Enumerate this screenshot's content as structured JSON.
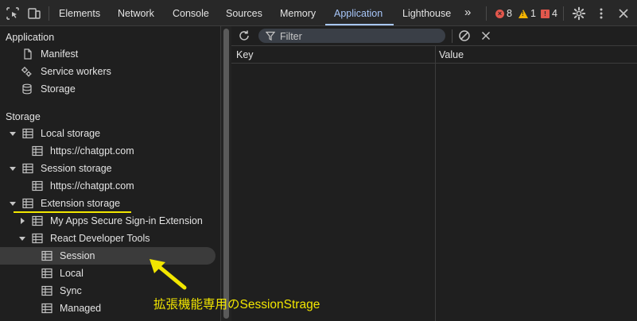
{
  "devtools": {
    "tabs": [
      {
        "label": "Elements"
      },
      {
        "label": "Network"
      },
      {
        "label": "Console"
      },
      {
        "label": "Sources"
      },
      {
        "label": "Memory"
      },
      {
        "label": "Application"
      },
      {
        "label": "Lighthouse"
      }
    ],
    "active_tab": "Application",
    "more_tabs_glyph": "»",
    "counts": {
      "errors": "8",
      "warnings": "1",
      "issues": "4"
    }
  },
  "sidebar": {
    "application_header": "Application",
    "application_items": [
      {
        "label": "Manifest",
        "icon": "document-icon"
      },
      {
        "label": "Service workers",
        "icon": "gears-icon"
      },
      {
        "label": "Storage",
        "icon": "database-icon"
      }
    ],
    "storage_header": "Storage",
    "storage_tree": [
      {
        "label": "Local storage",
        "expanded": true
      },
      {
        "label": "https://chatgpt.com"
      },
      {
        "label": "Session storage",
        "expanded": true
      },
      {
        "label": "https://chatgpt.com"
      },
      {
        "label": "Extension storage",
        "expanded": true
      },
      {
        "label": "My Apps Secure Sign-in Extension",
        "expanded": false
      },
      {
        "label": "React Developer Tools",
        "expanded": true
      },
      {
        "label": "Session",
        "selected": true
      },
      {
        "label": "Local"
      },
      {
        "label": "Sync"
      },
      {
        "label": "Managed"
      }
    ]
  },
  "main": {
    "filter_placeholder": "Filter",
    "columns": [
      "Key",
      "Value"
    ]
  },
  "annotation": {
    "text": "拡張機能専用のSessionStrage",
    "color": "#f2e600"
  },
  "colors": {
    "accent": "#a8c7fa",
    "background": "#1f1f1f",
    "toolbar": "#282828",
    "error": "#e2574c",
    "warning": "#f4b400"
  }
}
